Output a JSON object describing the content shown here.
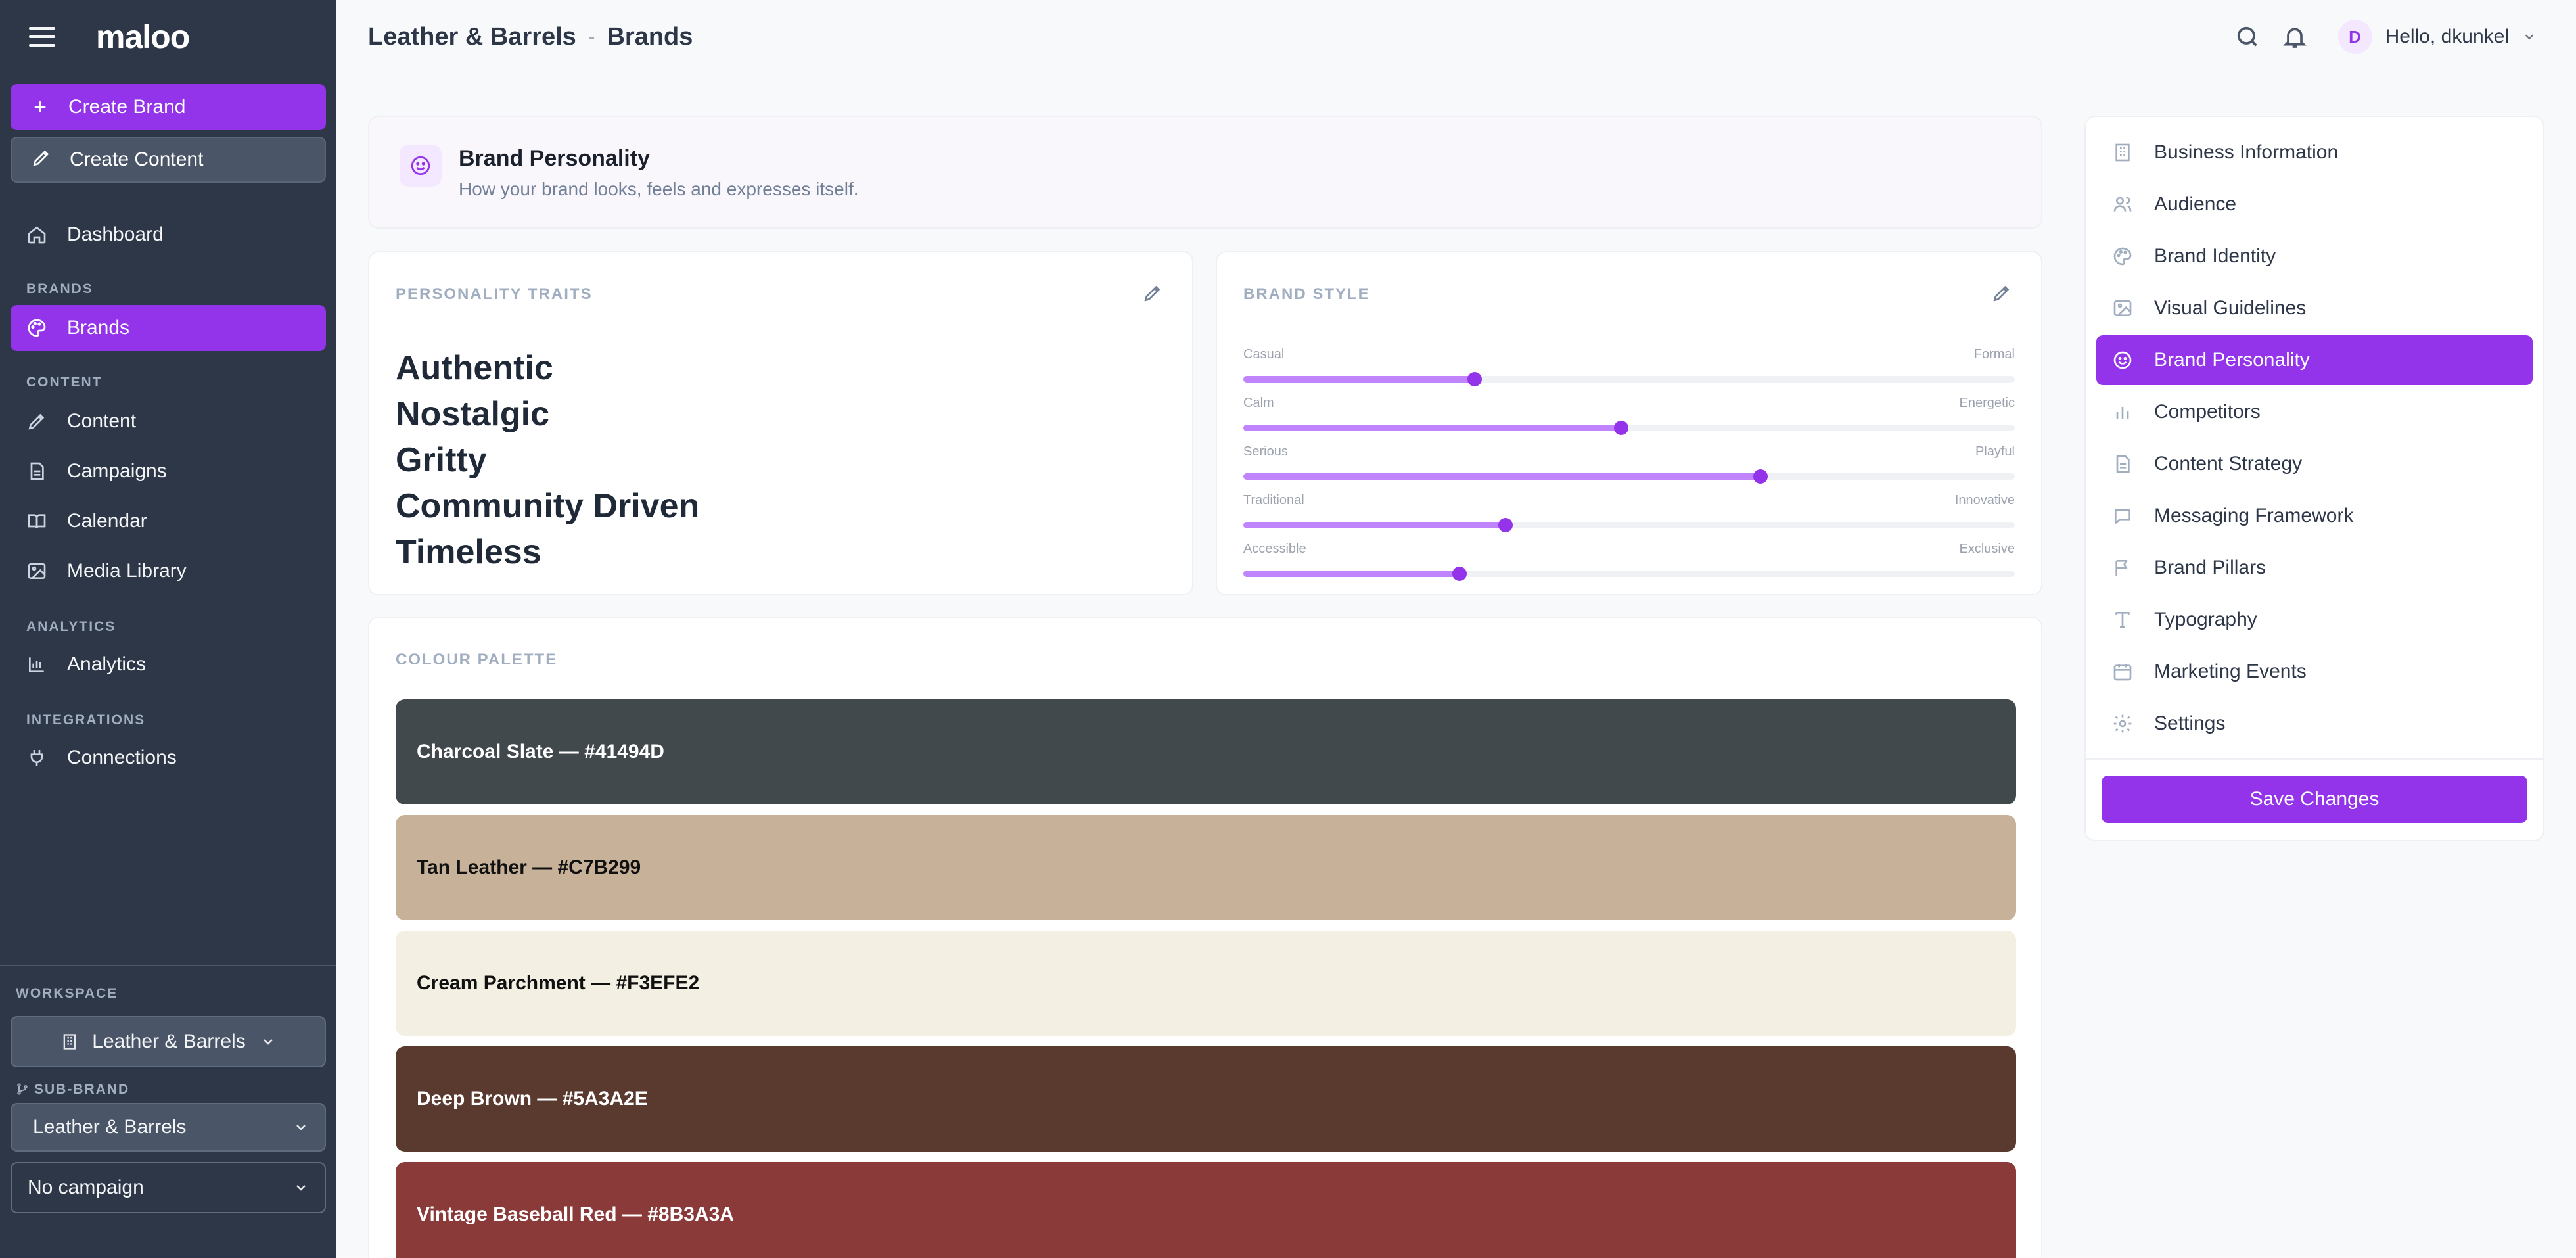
{
  "sidebar": {
    "logo": "maloo",
    "create_brand": "Create Brand",
    "create_content": "Create Content",
    "dashboard": "Dashboard",
    "section_brands": "BRANDS",
    "brands": "Brands",
    "section_content": "CONTENT",
    "content": "Content",
    "campaigns": "Campaigns",
    "calendar": "Calendar",
    "media_library": "Media Library",
    "section_analytics": "ANALYTICS",
    "analytics": "Analytics",
    "section_integrations": "INTEGRATIONS",
    "connections": "Connections",
    "workspace_label": "WORKSPACE",
    "workspace_value": "Leather & Barrels",
    "subbrand_label": "SUB-BRAND",
    "subbrand_value": "Leather & Barrels",
    "campaign_value": "No campaign"
  },
  "header": {
    "crumb_workspace": "Leather & Barrels",
    "crumb_separator": "-",
    "crumb_page": "Brands",
    "greeting": "Hello, dkunkel",
    "avatar_initial": "D"
  },
  "intro": {
    "title": "Brand Personality",
    "subtitle": "How your brand looks, feels and expresses itself."
  },
  "traits": {
    "title": "PERSONALITY TRAITS",
    "items": [
      "Authentic",
      "Nostalgic",
      "Gritty",
      "Community Driven",
      "Timeless"
    ]
  },
  "brand_style": {
    "title": "BRAND STYLE",
    "sliders": [
      {
        "left": "Casual",
        "right": "Formal",
        "value": 0.3
      },
      {
        "left": "Calm",
        "right": "Energetic",
        "value": 0.49
      },
      {
        "left": "Serious",
        "right": "Playful",
        "value": 0.67
      },
      {
        "left": "Traditional",
        "right": "Innovative",
        "value": 0.34
      },
      {
        "left": "Accessible",
        "right": "Exclusive",
        "value": 0.28
      }
    ]
  },
  "palette": {
    "title": "COLOUR PALETTE",
    "swatches": [
      {
        "label": "Charcoal Slate — #41494D",
        "color": "#41494D",
        "text_color": "#ffffff"
      },
      {
        "label": "Tan Leather — #C7B299",
        "color": "#C7B299",
        "text_color": "#111111"
      },
      {
        "label": "Cream Parchment — #F3EFE2",
        "color": "#F3EFE2",
        "text_color": "#111111"
      },
      {
        "label": "Deep Brown — #5A3A2E",
        "color": "#5A3A2E",
        "text_color": "#ffffff"
      },
      {
        "label": "Vintage Baseball Red — #8B3A3A",
        "color": "#8B3A3A",
        "text_color": "#ffffff"
      }
    ]
  },
  "right_nav": {
    "items": [
      {
        "label": "Business Information",
        "icon": "building-icon"
      },
      {
        "label": "Audience",
        "icon": "users-icon"
      },
      {
        "label": "Brand Identity",
        "icon": "palette-icon"
      },
      {
        "label": "Visual Guidelines",
        "icon": "image-icon"
      },
      {
        "label": "Brand Personality",
        "icon": "smile-icon"
      },
      {
        "label": "Competitors",
        "icon": "bar-chart-icon"
      },
      {
        "label": "Content Strategy",
        "icon": "document-icon"
      },
      {
        "label": "Messaging Framework",
        "icon": "message-icon"
      },
      {
        "label": "Brand Pillars",
        "icon": "flag-icon"
      },
      {
        "label": "Typography",
        "icon": "type-icon"
      },
      {
        "label": "Marketing Events",
        "icon": "calendar-icon"
      },
      {
        "label": "Settings",
        "icon": "gear-icon"
      }
    ],
    "active_index": 4,
    "save_label": "Save Changes"
  },
  "colors": {
    "accent": "#9333ea",
    "sidebar_bg": "#2d3748",
    "slider_fill": "#c084fc"
  }
}
